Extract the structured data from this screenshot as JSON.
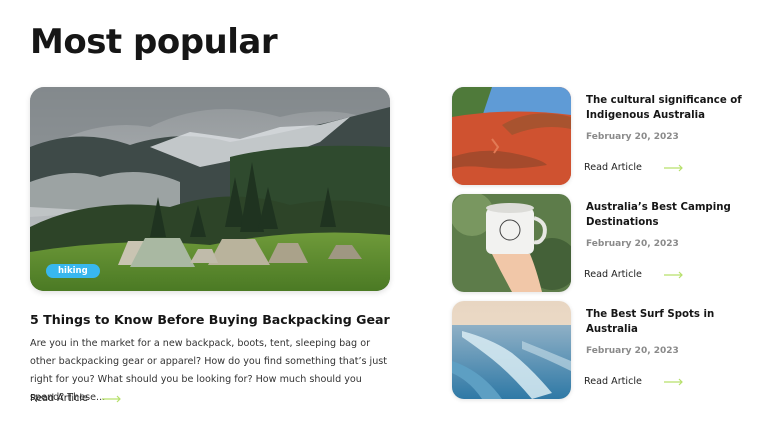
{
  "section_title": "Most popular",
  "colors": {
    "tag_bg": "#38b7ee",
    "arrow": "#b6e06b",
    "date": "#8a8a8a"
  },
  "featured": {
    "tag": "hiking",
    "title": "5 Things to Know Before Buying Backpacking Gear",
    "excerpt": "Are you in the market for a new backpack, boots, tent, sleeping bag or other backpacking gear or apparel? How do you find something that’s just right for you? What should you be looking for? How much should you spend? These...",
    "read_more": "Read Article",
    "image_icon": "mountain-camp-photo"
  },
  "articles": [
    {
      "title": "The cultural significance of Indigenous Australia",
      "date": "February 20, 2023",
      "read_more": "Read Article",
      "image_icon": "hands-red-sand-photo"
    },
    {
      "title": "Australia’s Best Camping Destinations",
      "date": "February 20, 2023",
      "read_more": "Read Article",
      "image_icon": "camp-mug-photo"
    },
    {
      "title": "The Best Surf Spots in Australia",
      "date": "February 20, 2023",
      "read_more": "Read Article",
      "image_icon": "ocean-wave-photo"
    }
  ]
}
